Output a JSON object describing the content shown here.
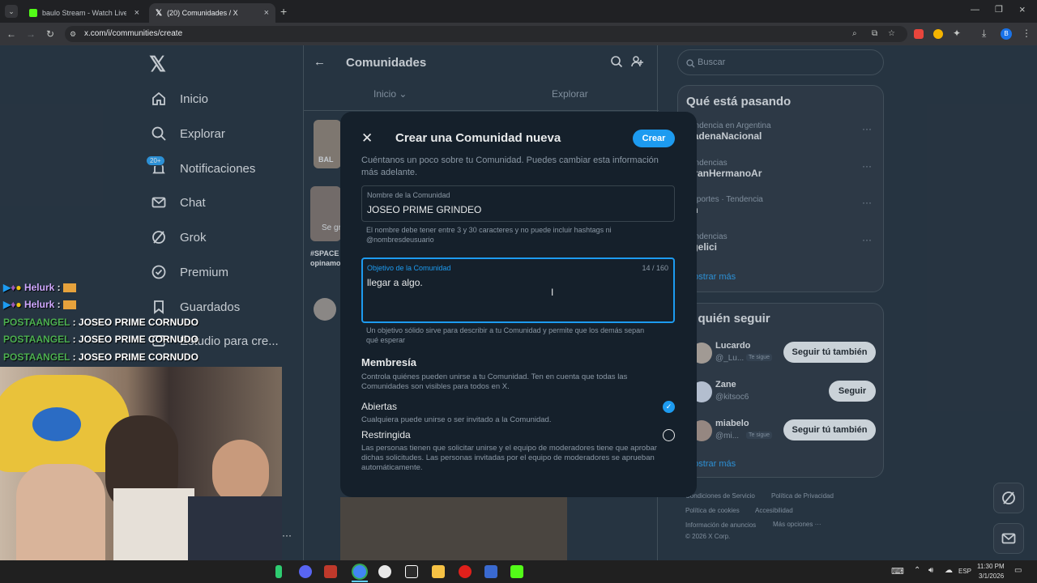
{
  "browser": {
    "tabs": [
      {
        "title": "baulo Stream - Watch Live"
      },
      {
        "title": "(20) Comunidades / X"
      }
    ],
    "url": "x.com/i/communities/create"
  },
  "nav": {
    "items": [
      "Inicio",
      "Explorar",
      "Notificaciones",
      "Chat",
      "Grok",
      "Premium",
      "Guardados",
      "Estudio para cre..."
    ],
    "notif_badge": "20+"
  },
  "center": {
    "title": "Comunidades",
    "tabs": [
      "Inicio",
      "Explorar"
    ],
    "post_snippets": [
      "BAL",
      "Se gr",
      "#SPACE",
      "opinamo"
    ]
  },
  "right": {
    "search_placeholder": "Buscar",
    "trends_title": "Qué está pasando",
    "trends": [
      {
        "meta": "Tendencia en Argentina",
        "name": "CadenaNacional"
      },
      {
        "meta": "Tendencias",
        "name": "GranHermanoAr"
      },
      {
        "meta": "Deportes · Tendencia",
        "name": "on"
      },
      {
        "meta": "Tendencias",
        "name": "ngelici"
      }
    ],
    "show_more": "Mostrar más",
    "follow_title": "A quién seguir",
    "follow": [
      {
        "name": "Lucardo",
        "handle": "@_Lu...",
        "badge": "Te sigue",
        "button": "Seguir tú también"
      },
      {
        "name": "Zane",
        "handle": "@kitsoc6",
        "badge": "",
        "button": "Seguir"
      },
      {
        "name": "miabelo",
        "handle": "@mi...",
        "badge": "Te sigue",
        "button": "Seguir tú también"
      }
    ],
    "show_more2": "Mostrar más",
    "footer": [
      "Condiciones de Servicio",
      "Política de Privacidad",
      "Política de cookies",
      "Accesibilidad",
      "Información de anuncios",
      "Más opciones ···",
      "© 2026 X Corp."
    ]
  },
  "modal": {
    "title": "Crear una Comunidad nueva",
    "create_button": "Crear",
    "intro": "Cuéntanos un poco sobre tu Comunidad. Puedes cambiar esta información más adelante.",
    "name_label": "Nombre de la Comunidad",
    "name_value": "JOSEO PRIME GRINDEO",
    "name_hint": "El nombre debe tener entre 3 y 30 caracteres y no puede incluir hashtags ni @nombresdeusuario",
    "purpose_label": "Objetivo de la Comunidad",
    "purpose_counter": "14 / 160",
    "purpose_value": "llegar a algo.",
    "purpose_hint": "Un objetivo sólido sirve para describir a tu Comunidad y permite que los demás sepan qué esperar",
    "membership_title": "Membresía",
    "membership_desc": "Controla quiénes pueden unirse a tu Comunidad. Ten en cuenta que todas las Comunidades son visibles para todos en X.",
    "options": [
      {
        "label": "Abiertas",
        "desc": "Cualquiera puede unirse o ser invitado a la Comunidad.",
        "selected": true
      },
      {
        "label": "Restringida",
        "desc": "Las personas tienen que solicitar unirse y el equipo de moderadores tiene que aprobar dichas solicitudes. Las personas invitadas por el equipo de moderadores se aprueban automáticamente.",
        "selected": false
      }
    ]
  },
  "stream_chat": [
    {
      "user": "Helurk",
      "msg": ""
    },
    {
      "user": "Helurk",
      "msg": ""
    },
    {
      "user": "POSTAANGEL",
      "msg": "JOSEO PRIME CORNUDO"
    },
    {
      "user": "POSTAANGEL",
      "msg": "JOSEO PRIME CORNUDO"
    },
    {
      "user": "POSTAANGEL",
      "msg": "JOSEO PRIME CORNUDO"
    }
  ],
  "taskbar": {
    "lang": "ESP",
    "time": "11:30 PM",
    "date": "3/1/2026"
  },
  "colors": {
    "accent": "#1d9bf0",
    "bg": "#15202b",
    "border": "#38444d"
  }
}
